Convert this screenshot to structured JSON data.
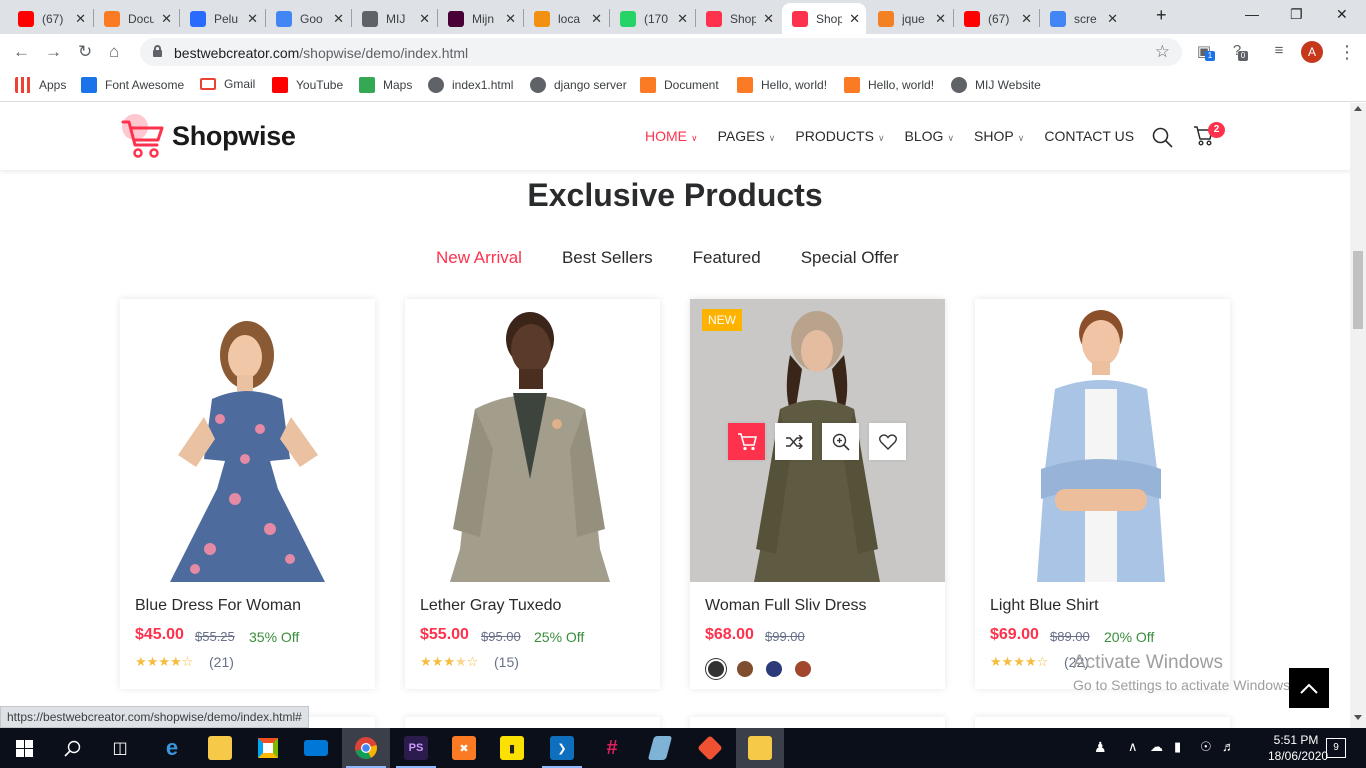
{
  "browser": {
    "tabs": [
      {
        "title": "(67)",
        "favicon": "youtube-icon",
        "color": "#ff0000"
      },
      {
        "title": "Docu",
        "favicon": "xampp-icon",
        "color": "#fb7a24"
      },
      {
        "title": "Pelu",
        "favicon": "shield-icon",
        "color": "#2a6bff"
      },
      {
        "title": "Goo",
        "favicon": "google-icon",
        "color": "#4285f4"
      },
      {
        "title": "MIJ",
        "favicon": "globe-icon",
        "color": "#5f6368"
      },
      {
        "title": "Mijn",
        "favicon": "xd-icon",
        "color": "#470137"
      },
      {
        "title": "loca",
        "favicon": "phpmyadmin-icon",
        "color": "#f29111"
      },
      {
        "title": "(170",
        "favicon": "whatsapp-icon",
        "color": "#25d366"
      },
      {
        "title": "Shop",
        "favicon": "cart-icon",
        "color": "#ff324d"
      },
      {
        "title": "Shop",
        "favicon": "cart-icon",
        "color": "#ff324d"
      },
      {
        "title": "jque",
        "favicon": "stackoverflow-icon",
        "color": "#f48024"
      },
      {
        "title": "(67)",
        "favicon": "youtube-icon",
        "color": "#ff0000"
      },
      {
        "title": "scre",
        "favicon": "google-icon",
        "color": "#4285f4"
      }
    ],
    "active_tab_index": 9,
    "url_host": "bestwebcreator.com",
    "url_path": "/shopwise/demo/index.html",
    "extension_badges": [
      "1",
      "0"
    ],
    "profile_initial": "A",
    "bookmarks": [
      {
        "label": "Apps",
        "icon": "apps-grid-icon"
      },
      {
        "label": "Font Awesome",
        "icon": "flag-icon"
      },
      {
        "label": "Gmail",
        "icon": "gmail-icon"
      },
      {
        "label": "YouTube",
        "icon": "youtube-icon"
      },
      {
        "label": "Maps",
        "icon": "maps-pin-icon"
      },
      {
        "label": "index1.html",
        "icon": "globe-icon"
      },
      {
        "label": "django server",
        "icon": "globe-icon"
      },
      {
        "label": "Document",
        "icon": "xampp-icon"
      },
      {
        "label": "Hello, world!",
        "icon": "xampp-icon"
      },
      {
        "label": "Hello, world!",
        "icon": "xampp-icon"
      },
      {
        "label": "MIJ Website",
        "icon": "globe-icon"
      }
    ],
    "status_url": "https://bestwebcreator.com/shopwise/demo/index.html#"
  },
  "site": {
    "brand": "Shopwise",
    "accent": "#ff324d",
    "menu": [
      {
        "label": "HOME",
        "active": true,
        "dropdown": true
      },
      {
        "label": "PAGES",
        "active": false,
        "dropdown": true
      },
      {
        "label": "PRODUCTS",
        "active": false,
        "dropdown": true
      },
      {
        "label": "BLOG",
        "active": false,
        "dropdown": true
      },
      {
        "label": "SHOP",
        "active": false,
        "dropdown": true
      },
      {
        "label": "CONTACT US",
        "active": false,
        "dropdown": false
      }
    ],
    "cart_count": "2"
  },
  "section": {
    "title": "Exclusive Products",
    "tabs": [
      "New Arrival",
      "Best Sellers",
      "Featured",
      "Special Offer"
    ],
    "active_tab": 0
  },
  "products": [
    {
      "name": "Blue Dress For Woman",
      "price": "$45.00",
      "old_price": "$55.25",
      "discount": "35% Off",
      "rating": 4,
      "reviews": "(21)",
      "badge": ""
    },
    {
      "name": "Lether Gray Tuxedo",
      "price": "$55.00",
      "old_price": "$95.00",
      "discount": "25% Off",
      "rating": 3.5,
      "reviews": "(15)",
      "badge": ""
    },
    {
      "name": "Woman Full Sliv Dress",
      "price": "$68.00",
      "old_price": "$99.00",
      "discount": "",
      "rating": 0,
      "reviews": "",
      "badge": "NEW",
      "swatches": [
        "#333333",
        "#7f4e2f",
        "#2c3a7a",
        "#a0472e"
      ]
    },
    {
      "name": "Light Blue Shirt",
      "price": "$69.00",
      "old_price": "$89.00",
      "discount": "20% Off",
      "rating": 4,
      "reviews": "(22)",
      "badge": ""
    }
  ],
  "watermark": {
    "line1": "Activate Windows",
    "line2": "Go to Settings to activate Windows."
  },
  "taskbar": {
    "time": "5:51 PM",
    "date": "18/06/2020",
    "notification_count": "9"
  }
}
